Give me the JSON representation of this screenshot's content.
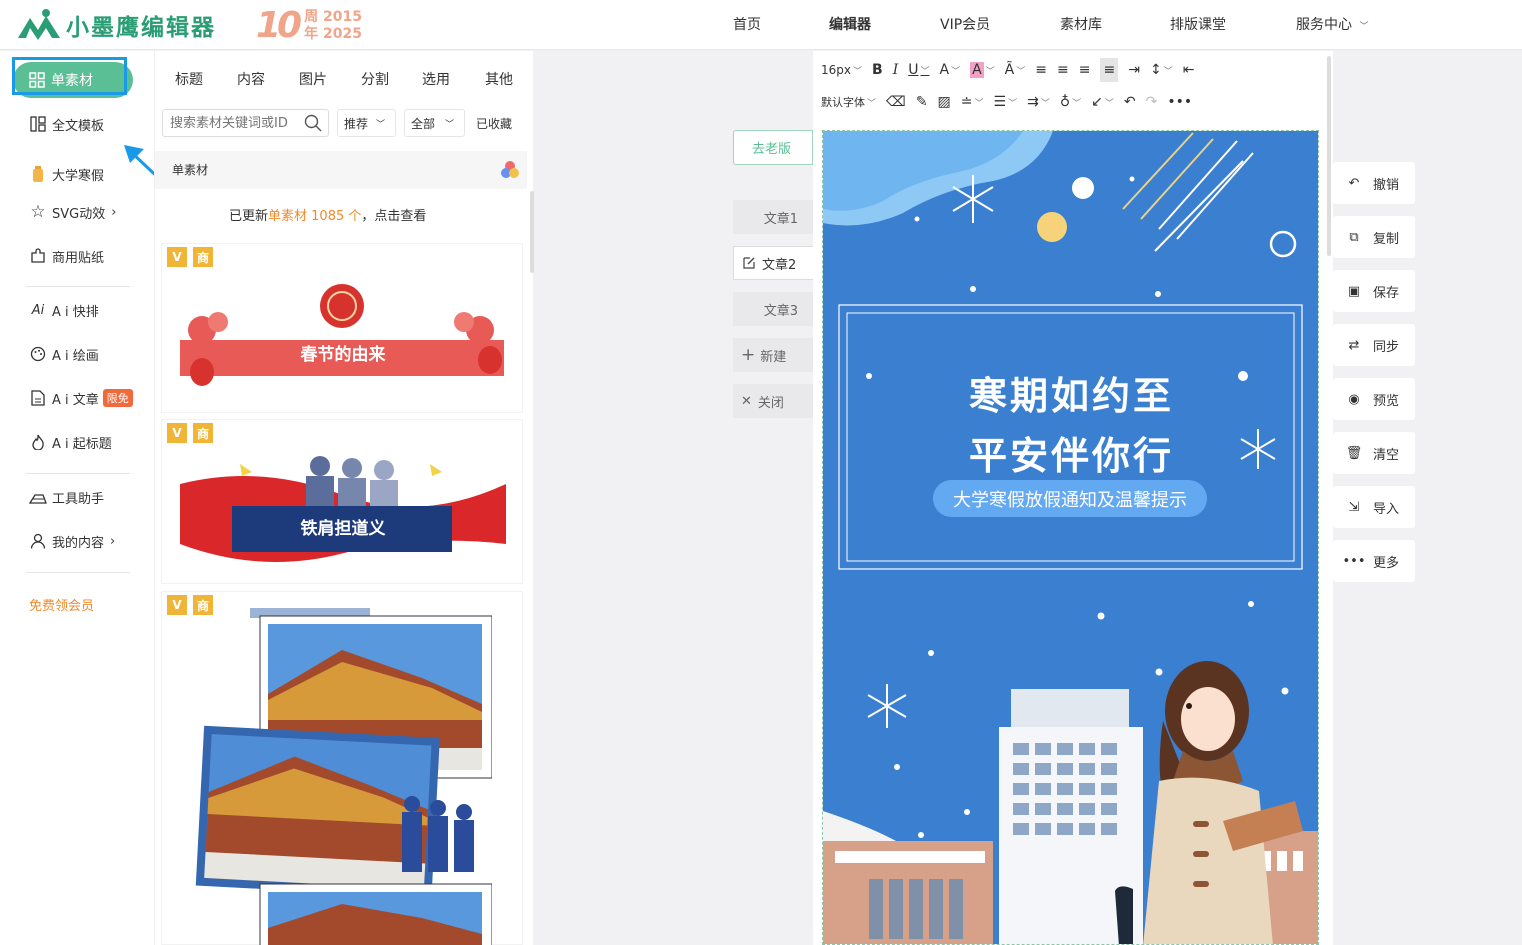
{
  "header": {
    "logo_text": "小墨鹰编辑器",
    "anniversary_number": "10",
    "anniversary_line1": "周 2015",
    "anniversary_line2": "年 2025",
    "nav": [
      "首页",
      "编辑器",
      "VIP会员",
      "素材库",
      "排版课堂",
      "服务中心"
    ],
    "active_nav": "编辑器"
  },
  "sidebar": {
    "primary": "单素材",
    "highlighted": "全文模板",
    "items": [
      "大学寒假",
      "SVG动效",
      "商用贴纸",
      "A i 快排",
      "A i 绘画",
      "A i 文章",
      "A i 起标题",
      "工具助手",
      "我的内容"
    ],
    "badge": "限免",
    "free_vip": "免费领会员"
  },
  "panel": {
    "tabs": [
      "标题",
      "内容",
      "图片",
      "分割",
      "选用",
      "其他"
    ],
    "search_placeholder": "搜索素材关键词或ID",
    "filter_sort": "推荐",
    "filter_scope": "全部",
    "favorites": "已收藏",
    "section": "单素材",
    "update_prefix": "已更新",
    "update_highlight": "单素材 1085 个",
    "update_suffix": "，点击查看",
    "tag_v": "V",
    "tag_s": "商",
    "card1_title": "春节的由来",
    "card2_title": "铁肩担道义"
  },
  "articles": {
    "old_version": "去老版",
    "items": [
      "文章1",
      "文章2",
      "文章3"
    ],
    "active": "文章2",
    "new": "新建",
    "close": "关闭"
  },
  "toolbar": {
    "font_size": "16px",
    "font_family": "默认字体"
  },
  "poster": {
    "line1": "寒期如约至",
    "line2": "平安伴你行",
    "subtitle": "大学寒假放假通知及温馨提示"
  },
  "actions": [
    "撤销",
    "复制",
    "保存",
    "同步",
    "预览",
    "清空",
    "导入",
    "更多"
  ],
  "colors": {
    "brand": "#2a9d74",
    "pill": "#5bbf95",
    "poster_blue": "#3a7fd0",
    "highlight": "#1a9ae6"
  }
}
